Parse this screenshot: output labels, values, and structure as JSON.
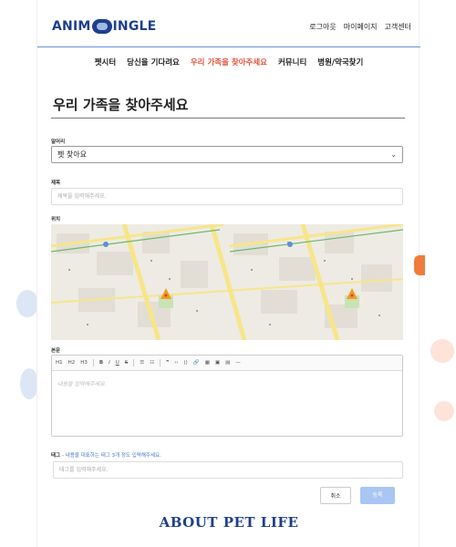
{
  "header": {
    "logo_left": "ANIM",
    "logo_right": "INGLE",
    "links": [
      "로그아웃",
      "마이페이지",
      "고객센터"
    ]
  },
  "nav": {
    "items": [
      "펫시터",
      "당신을 기다려요",
      "우리 가족을 찾아주세요",
      "커뮤니티",
      "병원/약국찾기"
    ],
    "active_index": 2
  },
  "page": {
    "title": "우리 가족을 찾아주세요"
  },
  "form": {
    "category": {
      "label": "말머리",
      "value": "펫 찾아요"
    },
    "title_field": {
      "label": "제목",
      "placeholder": "제목을 입력해주세요."
    },
    "location": {
      "label": "위치"
    },
    "body": {
      "label": "본문",
      "placeholder": "내용을 입력해주세요."
    },
    "tags": {
      "label": "태그",
      "hint": "- 내용을 대표하는 태그 3개 정도 입력해주세요.",
      "placeholder": "태그를 입력해주세요."
    }
  },
  "toolbar": [
    "H1",
    "H2",
    "H3",
    "B",
    "I",
    "U",
    "S",
    "☰",
    "☷",
    "❞",
    "‹›",
    "⟨⟩",
    "🔗",
    "▦",
    "▣",
    "▤",
    "—"
  ],
  "buttons": {
    "cancel": "취소",
    "submit": "등록"
  },
  "footer": {
    "brand": "ABOUT PET LIFE"
  },
  "colors": {
    "accent": "#e5543e",
    "brand": "#1f3f8c",
    "submit": "#a9c5f2"
  }
}
